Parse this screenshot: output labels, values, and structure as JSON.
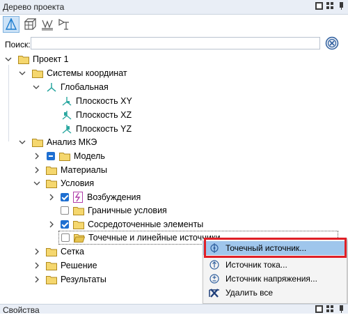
{
  "panel": {
    "title": "Дерево проекта"
  },
  "search": {
    "label": "Поиск:",
    "value": ""
  },
  "tree": {
    "project": "Проект 1",
    "coord_systems": "Системы координат",
    "global": "Глобальная",
    "plane_xy": "Плоскость XY",
    "plane_xz": "Плоскость XZ",
    "plane_yz": "Плоскость YZ",
    "fea": "Анализ МКЭ",
    "model": "Модель",
    "materials": "Материалы",
    "conditions": "Условия",
    "excitations": "Возбуждения",
    "boundary": "Граничные условия",
    "lumped": "Сосредоточенные элементы",
    "point_line_sources": "Точечные и линейные источники",
    "mesh": "Сетка",
    "solution": "Решение",
    "results": "Результаты"
  },
  "context_menu": {
    "items": [
      {
        "label": "Точечный источник...",
        "icon": "point-source-icon"
      },
      {
        "label": "Источник тока...",
        "icon": "current-source-icon"
      },
      {
        "label": "Источник напряжения...",
        "icon": "voltage-source-icon"
      },
      {
        "label": "Удалить все",
        "icon": "delete-all-icon"
      }
    ]
  },
  "bottom_panel": {
    "title": "Свойства"
  },
  "colors": {
    "highlight": "#9fc6ec",
    "accent": "#1e6fd1",
    "annotation": "#e01f26",
    "folder": "#f5d76e"
  }
}
